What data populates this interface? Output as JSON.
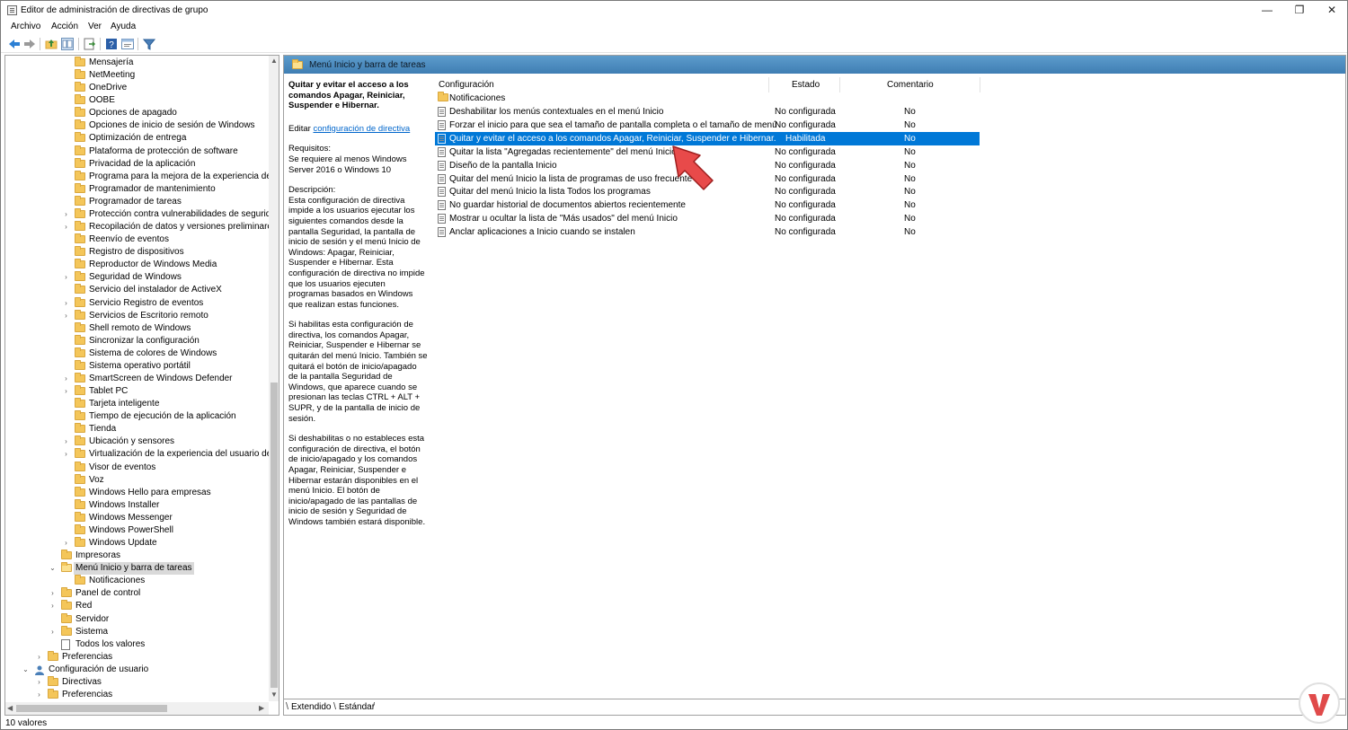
{
  "window": {
    "title": "Editor de administración de directivas de grupo",
    "minimize": "—",
    "maximize": "❐",
    "close": "✕"
  },
  "menu": [
    "Archivo",
    "Acción",
    "Ver",
    "Ayuda"
  ],
  "toolbar": {
    "icons": [
      "back-icon",
      "forward-icon",
      "up-folder-icon",
      "show-hide-tree-icon",
      "export-list-icon",
      "help-icon",
      "properties-icon",
      "filter-icon"
    ]
  },
  "tree": {
    "items": [
      {
        "label": "Mensajería"
      },
      {
        "label": "NetMeeting"
      },
      {
        "label": "OneDrive"
      },
      {
        "label": "OOBE"
      },
      {
        "label": "Opciones de apagado"
      },
      {
        "label": "Opciones de inicio de sesión de Windows"
      },
      {
        "label": "Optimización de entrega"
      },
      {
        "label": "Plataforma de protección de software"
      },
      {
        "label": "Privacidad de la aplicación"
      },
      {
        "label": "Programa para la mejora de la experiencia del us"
      },
      {
        "label": "Programador de mantenimiento"
      },
      {
        "label": "Programador de tareas"
      },
      {
        "label": "Protección contra vulnerabilidades de seguridad"
      },
      {
        "label": "Recopilación de datos y versiones preliminares"
      },
      {
        "label": "Reenvío de eventos"
      },
      {
        "label": "Registro de dispositivos"
      },
      {
        "label": "Reproductor de Windows Media"
      },
      {
        "label": "Seguridad de Windows"
      },
      {
        "label": "Servicio del instalador de ActiveX"
      },
      {
        "label": "Servicio Registro de eventos"
      },
      {
        "label": "Servicios de Escritorio remoto"
      },
      {
        "label": "Shell remoto de Windows"
      },
      {
        "label": "Sincronizar la configuración"
      },
      {
        "label": "Sistema de colores de Windows"
      },
      {
        "label": "Sistema operativo portátil"
      },
      {
        "label": "SmartScreen de Windows Defender"
      },
      {
        "label": "Tablet PC"
      },
      {
        "label": "Tarjeta inteligente"
      },
      {
        "label": "Tiempo de ejecución de la aplicación"
      },
      {
        "label": "Tienda"
      },
      {
        "label": "Ubicación y sensores"
      },
      {
        "label": "Virtualización de la experiencia del usuario de M"
      },
      {
        "label": "Visor de eventos"
      },
      {
        "label": "Voz"
      },
      {
        "label": "Windows Hello para empresas"
      },
      {
        "label": "Windows Installer"
      },
      {
        "label": "Windows Messenger"
      },
      {
        "label": "Windows PowerShell"
      },
      {
        "label": "Windows Update"
      },
      {
        "label": "Impresoras"
      },
      {
        "label": "Menú Inicio y barra de tareas"
      },
      {
        "label": "Notificaciones"
      },
      {
        "label": "Panel de control"
      },
      {
        "label": "Red"
      },
      {
        "label": "Servidor"
      },
      {
        "label": "Sistema"
      },
      {
        "label": "Todos los valores"
      },
      {
        "label": "Preferencias"
      },
      {
        "label": "Configuración de usuario"
      },
      {
        "label": "Directivas"
      },
      {
        "label": "Preferencias"
      }
    ],
    "expand_collapsed": "›",
    "expand_open": "⌄"
  },
  "right": {
    "header_title": "Menú Inicio y barra de tareas",
    "description": {
      "title": "Quitar y evitar el acceso a los comandos Apagar, Reiniciar, Suspender e Hibernar.",
      "edit_prefix": "Editar ",
      "edit_link": "configuración de directiva",
      "requirements_label": "Requisitos:",
      "requirements_text": "Se requiere al menos Windows Server 2016 o Windows 10",
      "description_label": "Descripción:",
      "description_text": "Esta configuración de directiva impide a los usuarios ejecutar los siguientes comandos desde la pantalla Seguridad, la pantalla de inicio de sesión y el menú Inicio de Windows: Apagar, Reiniciar, Suspender e Hibernar. Esta configuración de directiva no impide que los usuarios ejecuten programas basados en Windows que realizan estas funciones.",
      "enabled_text": "Si habilitas esta configuración de directiva, los comandos Apagar, Reiniciar, Suspender e Hibernar se quitarán del menú Inicio. También se quitará el botón de inicio/apagado de la pantalla Seguridad de Windows, que aparece cuando se presionan las teclas CTRL + ALT + SUPR, y de la pantalla de inicio de sesión.",
      "disabled_text": "Si deshabilitas o no estableces esta configuración de directiva, el botón de inicio/apagado y los comandos Apagar, Reiniciar, Suspender e Hibernar estarán disponibles en el menú Inicio. El botón de inicio/apagado de las pantallas de inicio de sesión y Seguridad de Windows también estará disponible."
    },
    "columns": {
      "config": "Configuración",
      "estado": "Estado",
      "comentario": "Comentario"
    },
    "folder_row": "Notificaciones",
    "rows": [
      {
        "name": "Deshabilitar los menús contextuales en el menú Inicio",
        "estado": "No configurada",
        "comentario": "No"
      },
      {
        "name": "Forzar el inicio para que sea el tamaño de pantalla completa o el tamaño de menú",
        "estado": "No configurada",
        "comentario": "No"
      },
      {
        "name": "Quitar y evitar el acceso a los comandos Apagar, Reiniciar, Suspender e Hibernar.",
        "estado": "Habilitada",
        "comentario": "No"
      },
      {
        "name": "Quitar la lista \"Agregadas recientemente\" del menú Inicio",
        "estado": "No configurada",
        "comentario": "No"
      },
      {
        "name": "Diseño de la pantalla Inicio",
        "estado": "No configurada",
        "comentario": "No"
      },
      {
        "name": "Quitar del menú Inicio la lista de programas de uso frecuente",
        "estado": "No configurada",
        "comentario": "No"
      },
      {
        "name": "Quitar del menú Inicio la lista Todos los programas",
        "estado": "No configurada",
        "comentario": "No"
      },
      {
        "name": "No guardar historial de documentos abiertos recientemente",
        "estado": "No configurada",
        "comentario": "No"
      },
      {
        "name": "Mostrar u ocultar la lista de \"Más usados\" del menú Inicio",
        "estado": "No configurada",
        "comentario": "No"
      },
      {
        "name": "Anclar aplicaciones a Inicio cuando se instalen",
        "estado": "No configurada",
        "comentario": "No"
      }
    ],
    "tabs": [
      "Extendido",
      "Estándar"
    ]
  },
  "status": {
    "text": "10 valores"
  },
  "colors": {
    "selection": "#0078d7",
    "header_band": "#3f7eb3",
    "callout_arrow": "#e84a4a"
  }
}
